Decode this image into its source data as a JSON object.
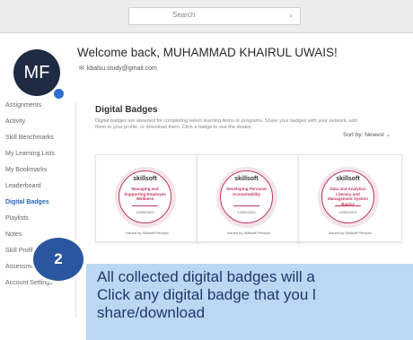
{
  "header": {
    "search_placeholder": "Search"
  },
  "profile": {
    "initials": "MF",
    "welcome": "Welcome back, MUHAMMAD KHAIRUL UWAIS!",
    "email": "kbalsu.study@gmail.com"
  },
  "sidebar": {
    "items": [
      {
        "label": "Assignments"
      },
      {
        "label": "Activity"
      },
      {
        "label": "Skill Benchmarks"
      },
      {
        "label": "My Learning Lists"
      },
      {
        "label": "My Bookmarks"
      },
      {
        "label": "Leaderboard"
      },
      {
        "label": "Digital Badges"
      },
      {
        "label": "Playlists"
      },
      {
        "label": "Notes"
      },
      {
        "label": "Skill Profile"
      },
      {
        "label": "Assessments"
      },
      {
        "label": "Account Settings"
      }
    ]
  },
  "section": {
    "title": "Digital Badges",
    "description": "Digital badges are awarded for completing select learning items or programs. Share your badges with your network, add them to your profile, or download them. Click a badge to see the details.",
    "sort": "Sort by: Newest ⌄"
  },
  "badges": [
    {
      "brand": "skillsoft",
      "name": "Managing and Supporting Employee Wellness",
      "date": "12/08/2023",
      "issued": "Issued by Skillsoft Percipio"
    },
    {
      "brand": "skillsoft",
      "name": "Developing Personal Accountability",
      "date": "12/05/2023",
      "issued": "Issued by Skillsoft Percipio"
    },
    {
      "brand": "skillsoft",
      "name": "Data and Analytics Literacy and Management System Basics",
      "date": "12/05/2023",
      "issued": "Issued by Skillsoft Percipio"
    }
  ],
  "callout": {
    "step": "2",
    "lines": [
      "All collected digital badges will a",
      "Click any digital badge that you l",
      "share/download"
    ]
  },
  "colors": {
    "accent": "#2a56a0",
    "callout_bg": "#bcd7f3",
    "badge_ring": "#c1385c"
  }
}
